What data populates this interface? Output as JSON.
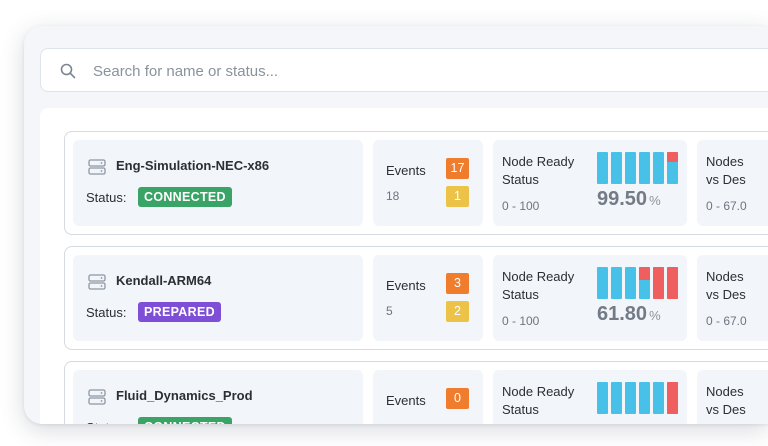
{
  "search": {
    "placeholder": "Search for name or status..."
  },
  "colors": {
    "connected": "#3aa366",
    "prepared": "#7e4ed6",
    "ok": "#47c1e8",
    "bad": "#ef5f5f",
    "events_orange": "#ef7d2d",
    "events_yellow": "#ecc347"
  },
  "labels": {
    "status": "Status:",
    "events": "Events",
    "node_ready_line1": "Node Ready",
    "node_ready_line2": "Status",
    "range": "0 - 100",
    "nodes_line1": "Nodes",
    "nodes_line2": "vs Des",
    "nodes_range": "0 - 67.0"
  },
  "clusters": [
    {
      "name": "Eng-Simulation-NEC-x86",
      "status": "CONNECTED",
      "status_color": "#3aa366",
      "events_total": "18",
      "events_orange": "17",
      "events_yellow": "1",
      "ready_value": "99.50",
      "ready_unit": "%",
      "bars_bad_fraction": [
        0,
        0,
        0,
        0,
        0,
        0.3
      ]
    },
    {
      "name": "Kendall-ARM64",
      "status": "PREPARED",
      "status_color": "#7e4ed6",
      "events_total": "5",
      "events_orange": "3",
      "events_yellow": "2",
      "ready_value": "61.80",
      "ready_unit": "%",
      "bars_bad_fraction": [
        0,
        0,
        0,
        0.4,
        1,
        1
      ]
    },
    {
      "name": "Fluid_Dynamics_Prod",
      "status": "CONNECTED",
      "status_color": "#3aa366",
      "events_total": "",
      "events_orange": "0",
      "events_yellow": "",
      "ready_value": "",
      "ready_unit": "",
      "bars_bad_fraction": [
        0,
        0,
        0,
        0,
        0,
        1
      ]
    }
  ]
}
